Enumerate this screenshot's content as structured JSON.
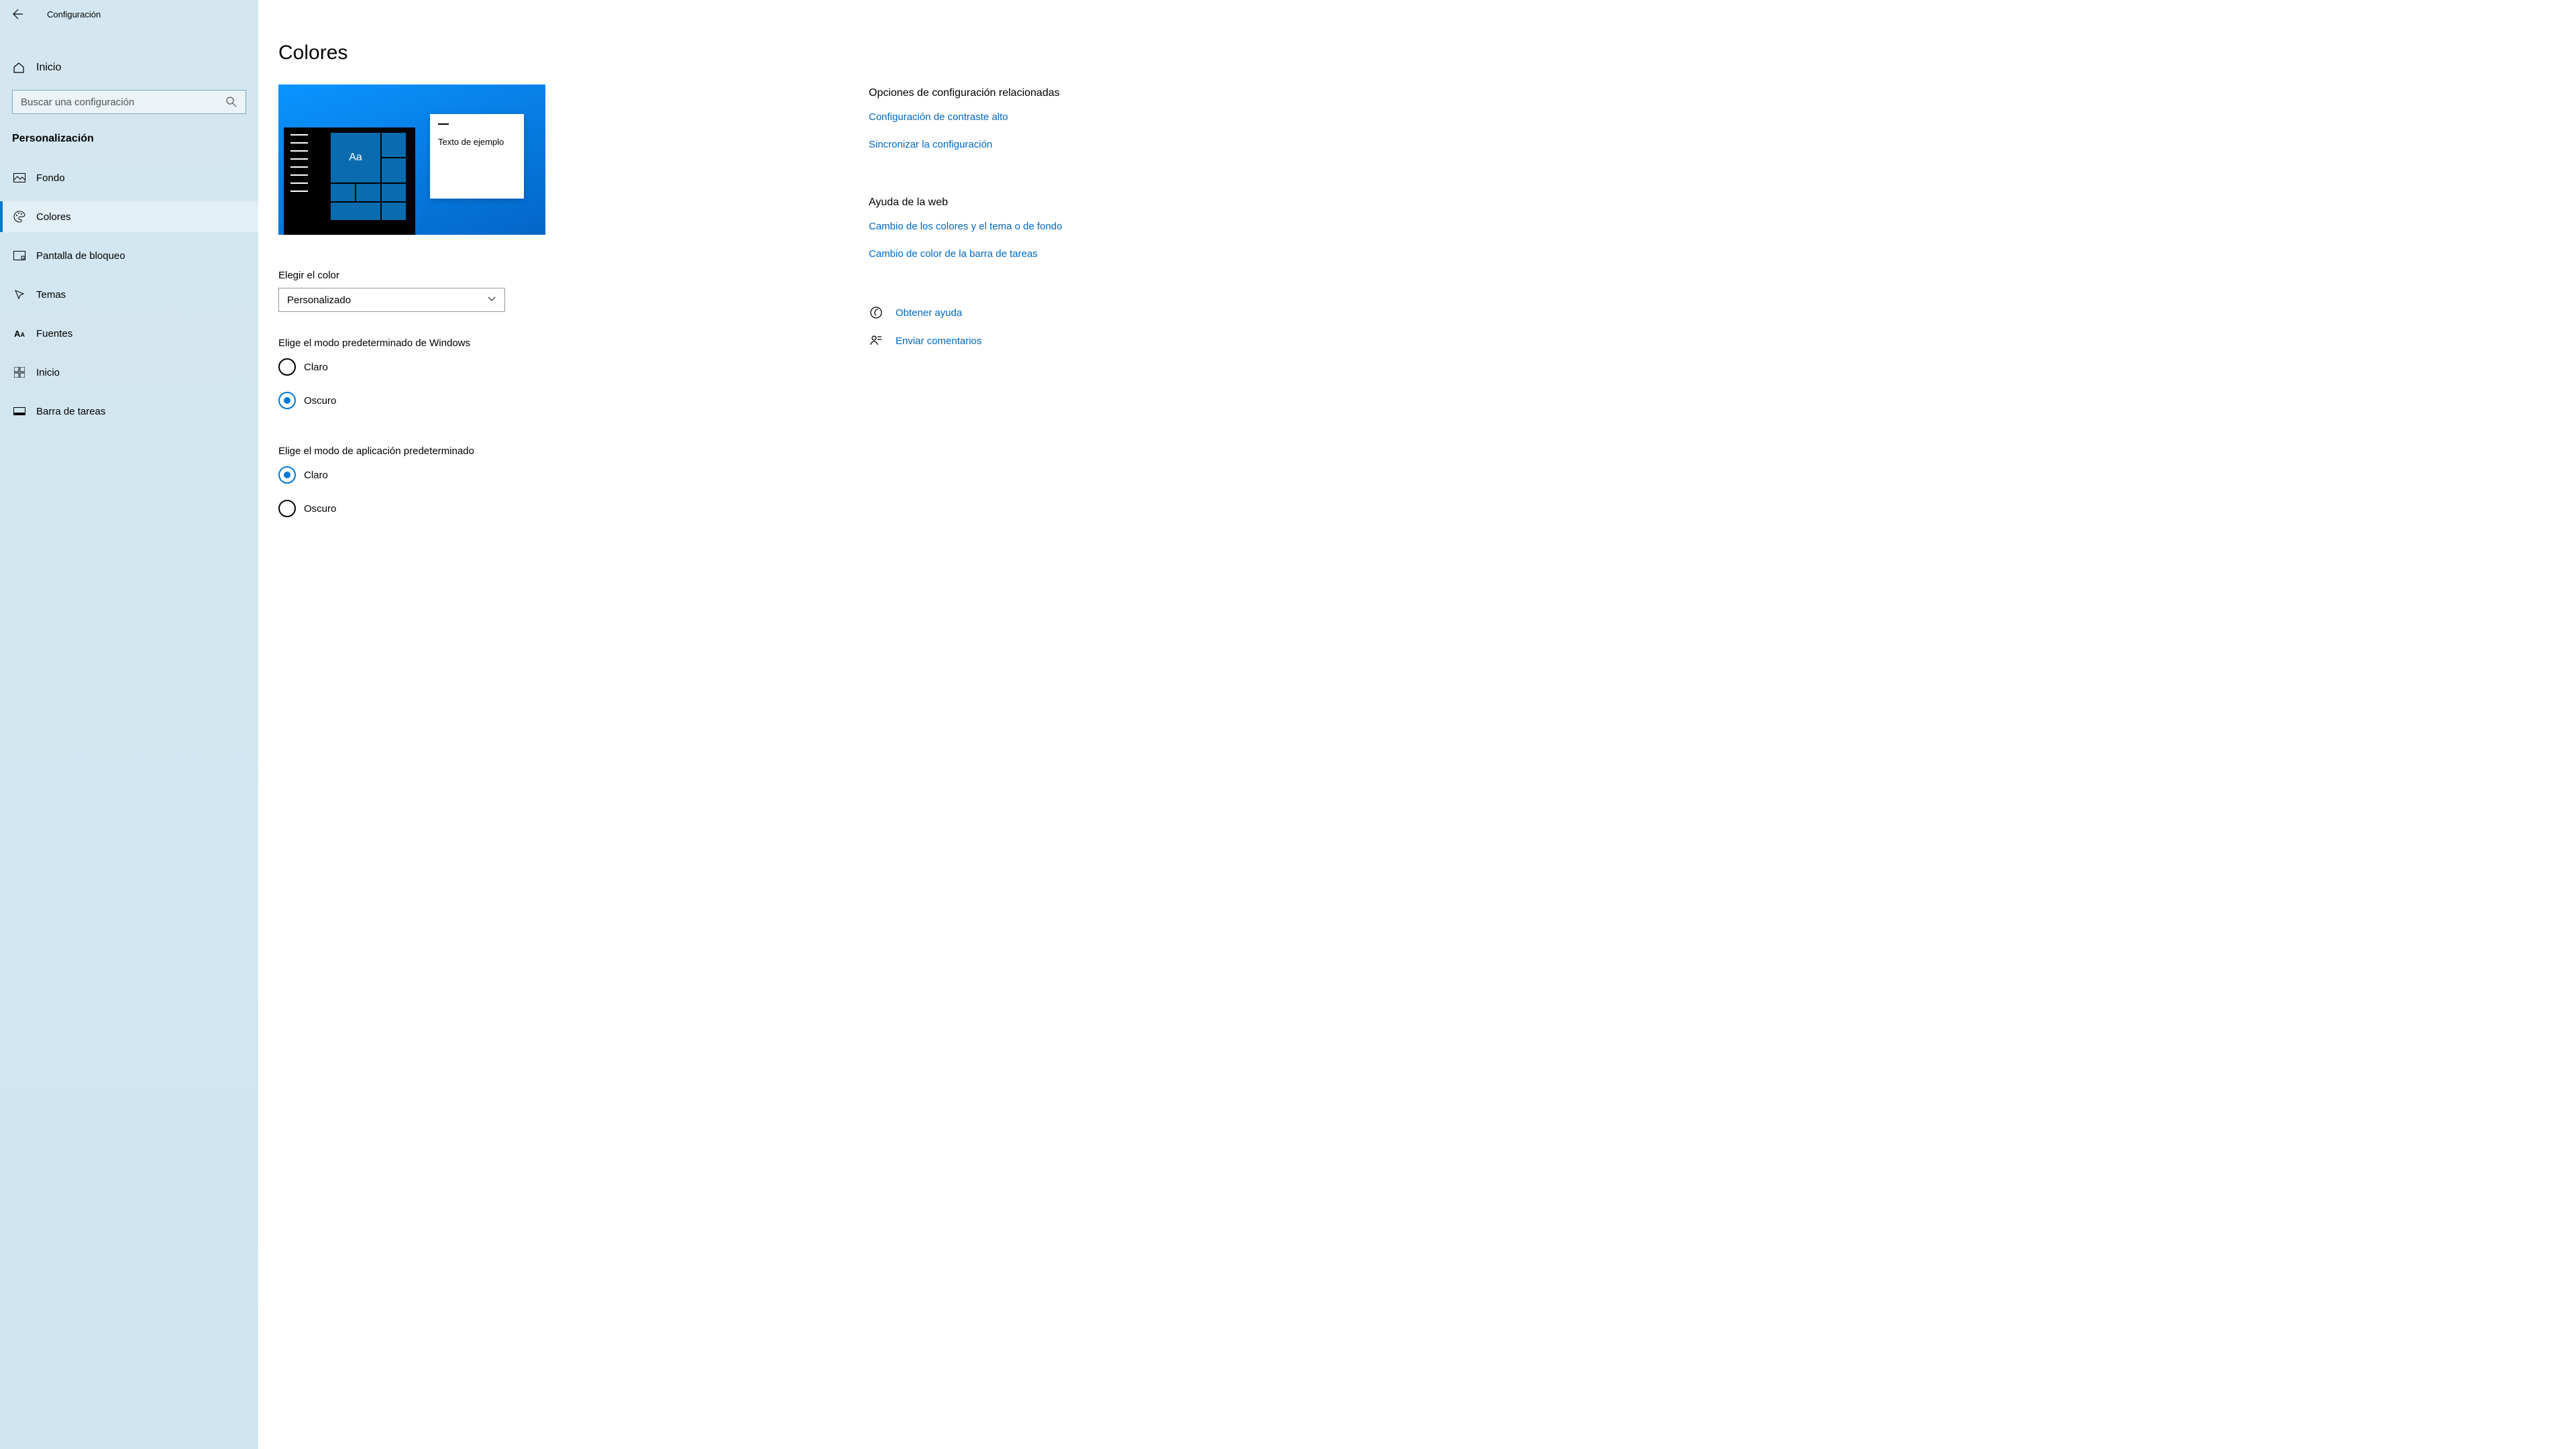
{
  "app_title": "Configuración",
  "home_label": "Inicio",
  "search_placeholder": "Buscar una configuración",
  "section_title": "Personalización",
  "nav": [
    {
      "label": "Fondo"
    },
    {
      "label": "Colores"
    },
    {
      "label": "Pantalla de bloqueo"
    },
    {
      "label": "Temas"
    },
    {
      "label": "Fuentes"
    },
    {
      "label": "Inicio"
    },
    {
      "label": "Barra de tareas"
    }
  ],
  "page_title": "Colores",
  "preview": {
    "tile_text": "Aa",
    "window_text": "Texto de ejemplo"
  },
  "color_select": {
    "label": "Elegir el color",
    "value": "Personalizado"
  },
  "windows_mode": {
    "label": "Elige el modo predeterminado de Windows",
    "options": [
      "Claro",
      "Oscuro"
    ],
    "selected": "Oscuro"
  },
  "app_mode": {
    "label": "Elige el modo de aplicación predeterminado",
    "options": [
      "Claro",
      "Oscuro"
    ],
    "selected": "Claro"
  },
  "right": {
    "related_heading": "Opciones de configuración relacionadas",
    "related_links": [
      "Configuración de contraste alto",
      "Sincronizar la configuración"
    ],
    "web_heading": "Ayuda de la web",
    "web_links": [
      "Cambio de los colores y el tema o de fondo",
      "Cambio de color de la barra de tareas"
    ],
    "help_link": "Obtener ayuda",
    "feedback_link": "Enviar comentarios"
  }
}
